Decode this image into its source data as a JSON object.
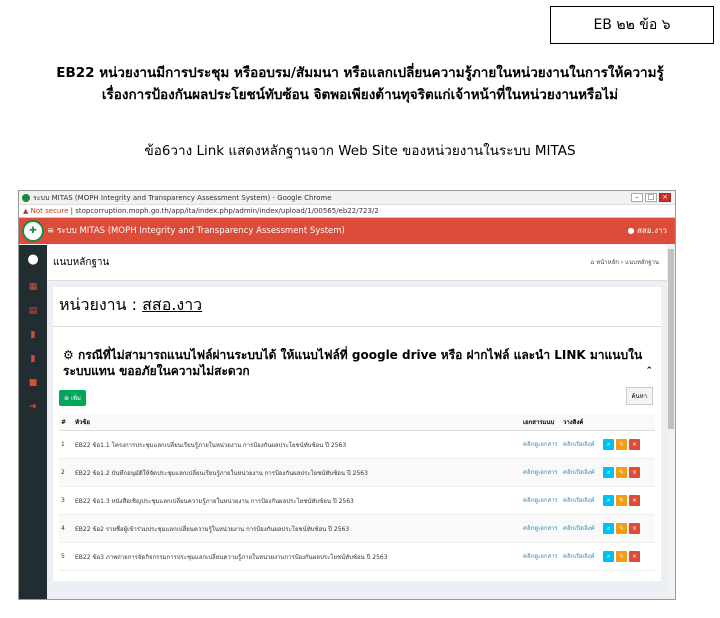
{
  "ref_label": "EB ๒๒ ข้อ ๖",
  "heading_line1": "EB22 หน่วยงานมีการประชุม หรืออบรม/สัมมนา หรือแลกเปลี่ยนความรู้ภายในหน่วยงานในการให้ความรู้",
  "heading_line2": "เรื่องการป้องกันผลประโยชน์ทับซ้อน จิตพอเพียงต้านทุจริตแก่เจ้าหน้าที่ในหน่วยงานหรือไม่",
  "heading_item": "ข้อ6วาง Link แสดงหลักฐานจาก Web Site ของหน่วยงานในระบบ MITAS",
  "browser": {
    "window_title": "ระบบ MITAS (MOPH Integrity and Transparency Assessment System) - Google Chrome",
    "not_secure": "Not secure",
    "url": "stopcorruption.moph.go.th/app/ita/index.php/admin/index/upload/1/00565/eb22/723/2"
  },
  "app": {
    "nav_title": "ระบบ MITAS (MOPH Integrity and Transparency Assessment System)",
    "user": "สสอ.งาว",
    "page_title": "แนบหลักฐาน",
    "breadcrumb_home": "หน้าหลัก",
    "breadcrumb_current": "แนบหลักฐาน",
    "agency_label": "หน่วยงาน :",
    "agency_name": "สสอ.งาว",
    "notice": "กรณีที่ไม่สามารถแนบไฟล์ผ่านระบบได้ ให้แนบไฟล์ที่ google drive หรือ ฝากไฟล์ และนำ LINK มาแนบในระบบแทน ขออภัยในความไม่สะดวก",
    "add_button": "เพิ่ม",
    "search_button": "ค้นหา",
    "columns": [
      "#",
      "หัวข้อ",
      "เอกสารแนบ",
      "วางลิงค์",
      ""
    ],
    "doc_link_label": "คลิกดูเอกสาร",
    "open_link_label": "คลิกเปิดลิงค์",
    "rows": [
      {
        "no": "1",
        "title": "EB22 ข้อ1.1 โครงการประชุมแลกเปลี่ยนเรียนรู้ภายในหน่วยงาน การป้องกันผลประโยชน์ทับซ้อน ปี 2563"
      },
      {
        "no": "2",
        "title": "EB22 ข้อ1.2 บันทึกอนุมัติให้จัดประชุมแลกเปลี่ยนเรียนรู้ภายในหน่วยงาน การป้องกันผลประโยชน์ทับซ้อน ปี 2563"
      },
      {
        "no": "3",
        "title": "EB22 ข้อ1.3 หนังสือเชิญประชุมแลกเปลี่ยนความรู้ภายในหน่วยงาน การป้องกันผลประโยชน์ทับซ้อน ปี 2563"
      },
      {
        "no": "4",
        "title": "EB22 ข้อ2 รายชื่อผู้เข้าร่วมประชุมแลกเปลี่ยนความรู้ในหน่วยงาน การป้องกันผลประโยชน์ทับซ้อน ปี 2563"
      },
      {
        "no": "5",
        "title": "EB22 ข้อ3 ภาพถ่ายการจัดกิจกรรมการประชุมแลกเปลี่ยนความรู้ภายในหน่วยงานการป้องกันผลประโยชน์ทับซ้อน ปี 2563"
      }
    ]
  }
}
